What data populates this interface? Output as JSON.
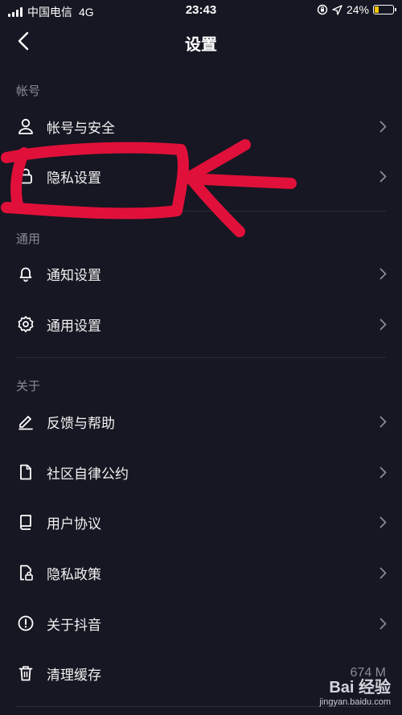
{
  "status_bar": {
    "carrier": "中国电信",
    "network": "4G",
    "time": "23:43",
    "battery_percent": "24%",
    "battery_level": 0.24,
    "battery_color": "#f5c400"
  },
  "header": {
    "title": "设置",
    "back_icon": "chevron-left-icon"
  },
  "sections": [
    {
      "title": "帐号",
      "items": [
        {
          "label": "帐号与安全",
          "icon": "user-icon"
        },
        {
          "label": "隐私设置",
          "icon": "lock-icon"
        }
      ]
    },
    {
      "title": "通用",
      "items": [
        {
          "label": "通知设置",
          "icon": "bell-icon"
        },
        {
          "label": "通用设置",
          "icon": "gear-icon"
        }
      ]
    },
    {
      "title": "关于",
      "items": [
        {
          "label": "反馈与帮助",
          "icon": "edit-icon"
        },
        {
          "label": "社区自律公约",
          "icon": "document-icon"
        },
        {
          "label": "用户协议",
          "icon": "book-icon"
        },
        {
          "label": "隐私政策",
          "icon": "lock-document-icon"
        },
        {
          "label": "关于抖音",
          "icon": "info-icon"
        },
        {
          "label": "清理缓存",
          "icon": "trash-icon",
          "value": "674 M"
        }
      ]
    }
  ],
  "watermark": {
    "brand": "Bai 经验",
    "url": "jingyan.baidu.com"
  },
  "colors": {
    "background": "#161722",
    "annotation": "#e0103a",
    "muted_text": "#8a8b93"
  }
}
